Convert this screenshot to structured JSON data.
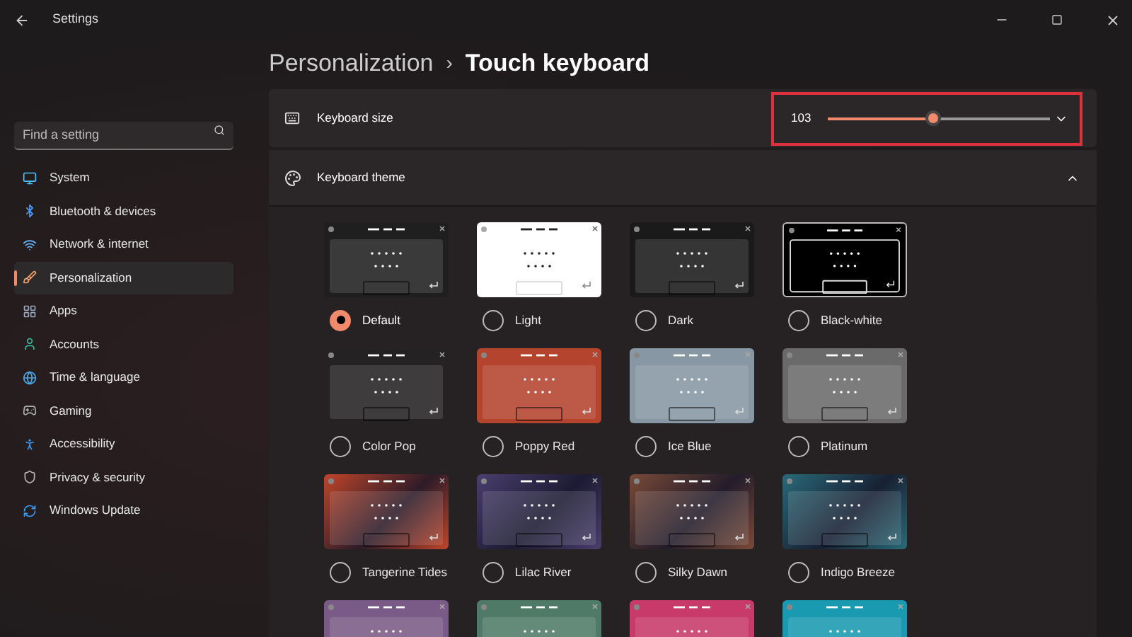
{
  "window": {
    "title": "Settings"
  },
  "search": {
    "placeholder": "Find a setting"
  },
  "nav": [
    {
      "label": "System",
      "selected": false
    },
    {
      "label": "Bluetooth & devices",
      "selected": false
    },
    {
      "label": "Network & internet",
      "selected": false
    },
    {
      "label": "Personalization",
      "selected": true
    },
    {
      "label": "Apps",
      "selected": false
    },
    {
      "label": "Accounts",
      "selected": false
    },
    {
      "label": "Time & language",
      "selected": false
    },
    {
      "label": "Gaming",
      "selected": false
    },
    {
      "label": "Accessibility",
      "selected": false
    },
    {
      "label": "Privacy & security",
      "selected": false
    },
    {
      "label": "Windows Update",
      "selected": false
    }
  ],
  "breadcrumb": {
    "parent": "Personalization",
    "separator": "›",
    "current": "Touch keyboard"
  },
  "keyboard_size": {
    "label": "Keyboard size",
    "reading": "103",
    "level": 0.46,
    "expanded": false
  },
  "keyboard_theme": {
    "label": "Keyboard theme",
    "expanded": true,
    "themes": [
      {
        "label": "Default",
        "selected": true,
        "kind": "plain",
        "color": "#1f1f1f"
      },
      {
        "label": "Light",
        "selected": false,
        "kind": "light",
        "color": "#ffffff"
      },
      {
        "label": "Dark",
        "selected": false,
        "kind": "plain",
        "color": "#1a1a1a"
      },
      {
        "label": "Black-white",
        "selected": false,
        "kind": "outline",
        "color": "#000000"
      },
      {
        "label": "Color Pop",
        "selected": false,
        "kind": "plain",
        "color": "#242222"
      },
      {
        "label": "Poppy Red",
        "selected": false,
        "kind": "plain",
        "color": "#b4442e"
      },
      {
        "label": "Ice Blue",
        "selected": false,
        "kind": "plain",
        "color": "#8797a3"
      },
      {
        "label": "Platinum",
        "selected": false,
        "kind": "plain",
        "color": "#6a6a6a"
      },
      {
        "label": "Tangerine Tides",
        "selected": false,
        "kind": "gradient",
        "color": "#c0452a"
      },
      {
        "label": "Lilac River",
        "selected": false,
        "kind": "gradient",
        "color": "#4a3f6e"
      },
      {
        "label": "Silky Dawn",
        "selected": false,
        "kind": "gradient",
        "color": "#7a4a38"
      },
      {
        "label": "Indigo Breeze",
        "selected": false,
        "kind": "gradient",
        "color": "#2a6a78"
      },
      {
        "kind": "plain",
        "color": "#7a5a86"
      },
      {
        "kind": "plain",
        "color": "#4f7a68"
      },
      {
        "kind": "plain",
        "color": "#c83a6a"
      },
      {
        "kind": "plain",
        "color": "#1a9ab0"
      }
    ]
  }
}
